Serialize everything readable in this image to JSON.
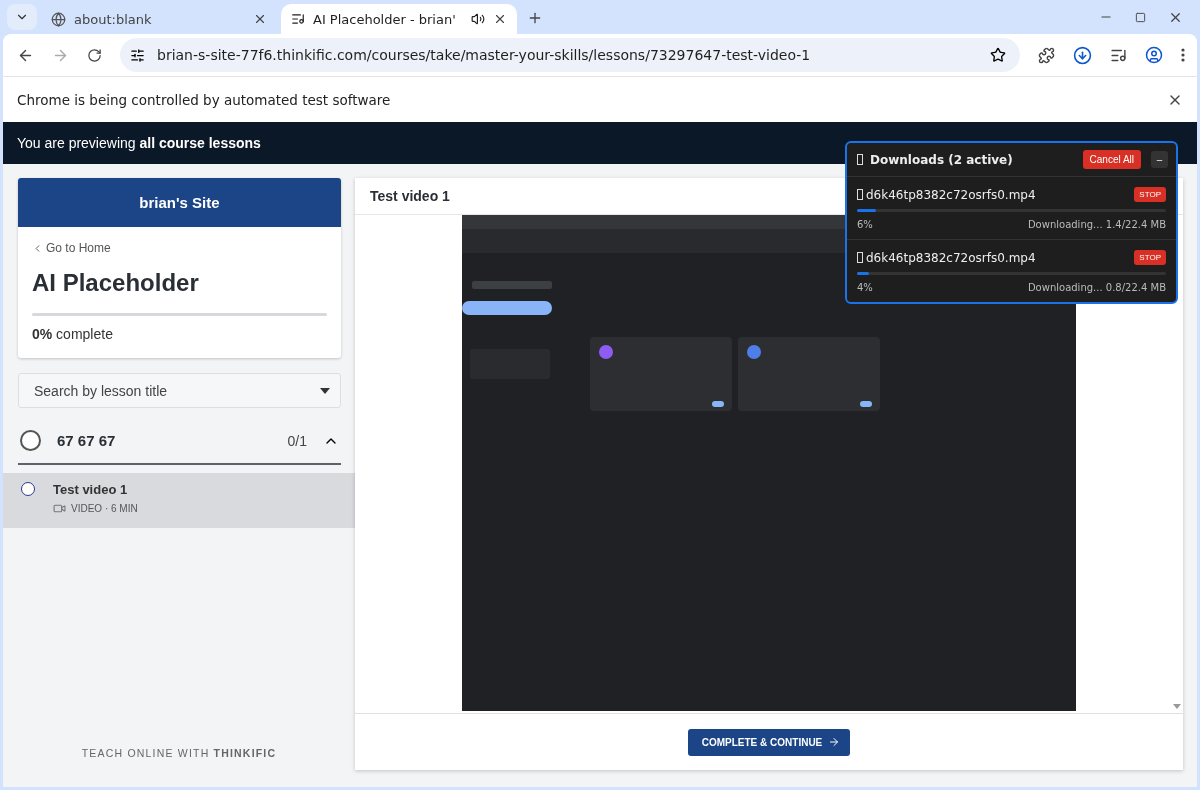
{
  "browser": {
    "tabs": [
      {
        "title": "about:blank",
        "selected": false,
        "audio": false
      },
      {
        "title": "AI Placeholder - brian'",
        "selected": true,
        "audio": true
      }
    ],
    "address": "brian-s-site-77f6.thinkific.com/courses/take/master-your-skills/lessons/73297647-test-video-1",
    "infobar": "Chrome is being controlled by automated test software"
  },
  "preview_banner": "You are previewing **all course lessons**",
  "sidebar": {
    "site_name": "brian's Site",
    "back_link": "Go to Home",
    "course_title": "AI Placeholder",
    "progress": {
      "level": 0,
      "label": "**0%** complete"
    },
    "search": {
      "placeholder": "Search by lesson title"
    },
    "chapters": [
      {
        "title": "67 67 67",
        "count": "0/1",
        "expanded": true,
        "lessons": [
          {
            "title": "Test video 1",
            "meta": "VIDEO · 6 MIN",
            "selected": true
          }
        ]
      }
    ],
    "footer": "TEACH ONLINE WITH **THINKIFIC**"
  },
  "lesson": {
    "title": "Test video 1",
    "action": "COMPLETE & CONTINUE"
  },
  "downloads": {
    "title": "Downloads (2 active)",
    "cancel_all": "Cancel All",
    "minimize": "−",
    "items": [
      {
        "file": "d6k46tp8382c72osrfs0.mp4",
        "action": "STOP",
        "level": 0.06,
        "percent": "6%",
        "status": "Downloading... 1.4/22.4 MB"
      },
      {
        "file": "d6k46tp8382c72osrfs0.mp4",
        "action": "STOP",
        "level": 0.04,
        "percent": "4%",
        "status": "Downloading... 0.8/22.4 MB"
      }
    ]
  }
}
